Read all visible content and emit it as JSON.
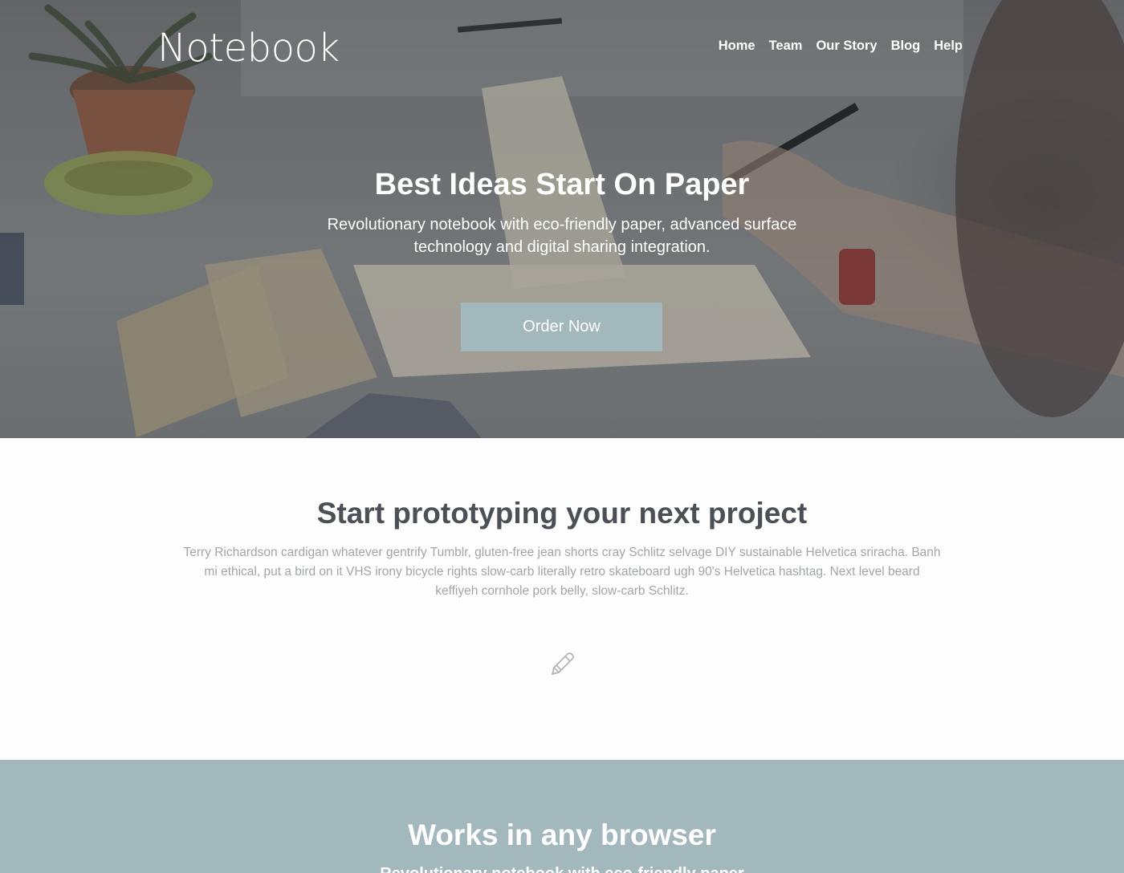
{
  "header": {
    "logo": "Notebook",
    "nav": [
      "Home",
      "Team",
      "Our Story",
      "Blog",
      "Help"
    ]
  },
  "hero": {
    "title": "Best Ideas Start On Paper",
    "subtitle": "Revolutionary notebook with eco-friendly paper, advanced surface technology and digital sharing integration.",
    "cta": "Order Now"
  },
  "intro": {
    "title": "Start prototyping your next project",
    "text": "Terry Richardson cardigan whatever gentrify Tumblr, gluten-free jean shorts cray Schlitz selvage DIY sustainable Helvetica sriracha. Banh mi ethical, put a bird on it VHS irony bicycle rights slow-carb literally retro skateboard ugh 90's Helvetica hashtag. Next level beard keffiyeh cornhole pork belly, slow-carb Schlitz.",
    "icon": "pencil-icon"
  },
  "browser": {
    "title": "Works in any browser",
    "subtitle": "Revolutionary notebook with eco-friendly paper"
  },
  "colors": {
    "accent": "#a3b8bd",
    "heading": "#4a5055",
    "body_text": "#a2a6aa"
  }
}
